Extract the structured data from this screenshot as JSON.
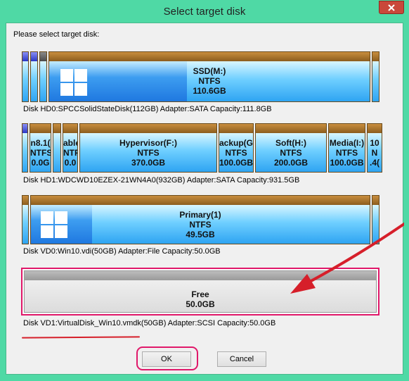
{
  "window": {
    "title": "Select target disk"
  },
  "prompt": "Please select target disk:",
  "disks": [
    {
      "info": "Disk HD0:SPCCSolidStateDisk(112GB)  Adapter:SATA  Capacity:111.8GB",
      "partitions": [
        {
          "lines": [
            "SSD(M:)",
            "NTFS",
            "110.6GB"
          ],
          "os_logo": true,
          "used_fraction": 0.43
        }
      ]
    },
    {
      "info": "Disk HD1:WDCWD10EZEX-21WN4A0(932GB)  Adapter:SATA  Capacity:931.5GB",
      "partitions": [
        {
          "lines": [
            "n8.1(",
            "NTFS",
            "0.0G"
          ]
        },
        {
          "lines": [
            "able",
            "NTFS",
            "0.0"
          ]
        },
        {
          "lines": [
            "Hypervisor(F:)",
            "NTFS",
            "370.0GB"
          ]
        },
        {
          "lines": [
            "ackup(G",
            "NTFS",
            "100.0GB"
          ]
        },
        {
          "lines": [
            "Soft(H:)",
            "NTFS",
            "200.0GB"
          ]
        },
        {
          "lines": [
            "Media(I:)",
            "NTFS",
            "100.0GB"
          ]
        },
        {
          "lines": [
            "10",
            "N",
            ".4("
          ]
        }
      ]
    },
    {
      "info": "Disk VD0:Win10.vdi(50GB)  Adapter:File  Capacity:50.0GB",
      "partitions": [
        {
          "lines": [
            "Primary(1)",
            "NTFS",
            "49.5GB"
          ],
          "os_logo": true
        }
      ]
    },
    {
      "info_name": "Disk VD1:VirtualDisk_Win10.vmdk(50GB)",
      "info_rest": "  Adapter:SCSI  Capacity:50.0GB",
      "partitions": [
        {
          "lines": [
            "Free",
            "50.0GB"
          ]
        }
      ]
    }
  ],
  "buttons": {
    "ok": "OK",
    "cancel": "Cancel"
  },
  "colors": {
    "highlight": "#e0186a",
    "annotation_red": "#d61f2a",
    "title_bar": "#4fd9a5"
  }
}
